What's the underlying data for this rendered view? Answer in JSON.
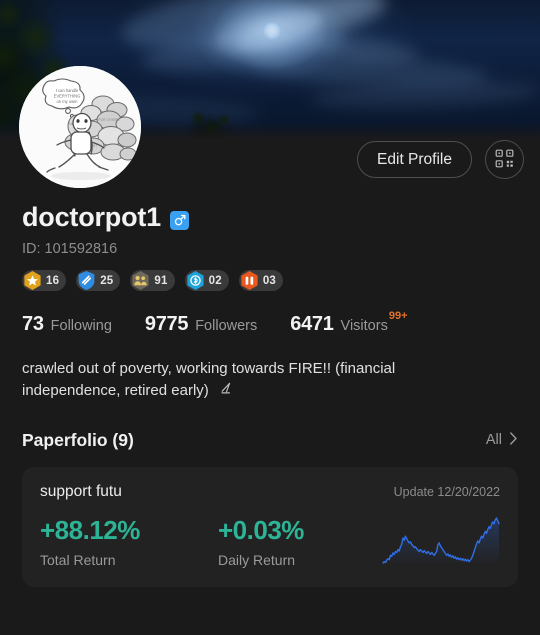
{
  "header": {
    "banner_alt": "night-sky-moon-clouds-banner",
    "avatar_alt": "cartoon-figure-carrying-rocks-avatar",
    "edit_profile_label": "Edit Profile",
    "qr_icon": "qr-code-icon"
  },
  "profile": {
    "username": "doctorpot1",
    "gender_icon": "male-symbol-icon",
    "id_label": "ID: 101592816",
    "bio": "crawled out of poverty, working towards FIRE!! (financial independence, retired early)",
    "bio_edit_icon": "pencil-icon"
  },
  "badges": [
    {
      "icon": "star-icon",
      "count": "16",
      "color": "#e0a21d"
    },
    {
      "icon": "shield-icon",
      "count": "25",
      "color": "#2f8ce0"
    },
    {
      "icon": "people-icon",
      "count": "91",
      "color": "#6f6a5c"
    },
    {
      "icon": "coin-icon",
      "count": "02",
      "color": "#1ea2d8"
    },
    {
      "icon": "bars-icon",
      "count": "03",
      "color": "#e8581f"
    }
  ],
  "stats": [
    {
      "value": "73",
      "label": "Following",
      "superscript": ""
    },
    {
      "value": "9775",
      "label": "Followers",
      "superscript": ""
    },
    {
      "value": "6471",
      "label": "Visitors",
      "superscript": "99+"
    }
  ],
  "paperfolio": {
    "section_title": "Paperfolio (9)",
    "all_label": "All",
    "chevron_icon": "chevron-right-icon"
  },
  "portfolio_card": {
    "name": "support futu",
    "update": "Update 12/20/2022",
    "total_return_value": "+88.12%",
    "total_return_label": "Total Return",
    "daily_return_value": "+0.03%",
    "daily_return_label": "Daily Return",
    "positive_color": "#2db395",
    "sparkline_color": "#2f6fe8"
  },
  "chart_data": {
    "type": "line",
    "title": "support futu portfolio performance sparkline",
    "xlabel": "",
    "ylabel": "",
    "grid": false,
    "legend": "none",
    "series": [
      {
        "name": "support futu cumulative return",
        "color": "#2f6fe8",
        "values": [
          6,
          9,
          7,
          12,
          15,
          13,
          22,
          20,
          27,
          24,
          30,
          28,
          34,
          31,
          40,
          45,
          58,
          54,
          62,
          57,
          52,
          48,
          50,
          45,
          42,
          38,
          40,
          36,
          33,
          30,
          34,
          31,
          28,
          32,
          29,
          26,
          30,
          27,
          24,
          28,
          25,
          22,
          26,
          30,
          44,
          48,
          42,
          38,
          34,
          30,
          26,
          22,
          25,
          20,
          23,
          18,
          21,
          16,
          19,
          14,
          17,
          13,
          16,
          12,
          15,
          11,
          14,
          10,
          13,
          9,
          12,
          16,
          22,
          30,
          38,
          46,
          52,
          48,
          56,
          62,
          58,
          66,
          72,
          68,
          76,
          82,
          78,
          86,
          92,
          88,
          96,
          100,
          94,
          88
        ]
      }
    ],
    "ylim": [
      0,
      100
    ],
    "note": "rises early, mid-range decline, sharp rally at the end, slight pullback on final point"
  }
}
